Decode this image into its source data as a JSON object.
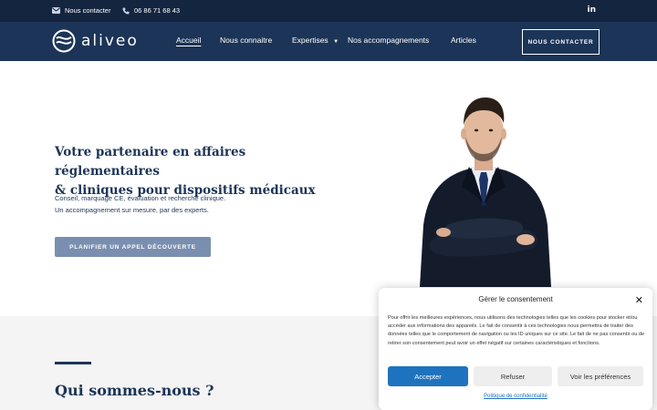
{
  "topbar": {
    "contact_label": "Nous contacter",
    "phone": "06 86 71 68 43",
    "linkedin": "in"
  },
  "nav": {
    "logo_text": "aliveo",
    "items": [
      {
        "label": "Accueil"
      },
      {
        "label": "Nous connaitre"
      },
      {
        "label": "Expertises"
      },
      {
        "label": "Nos accompagnements"
      },
      {
        "label": "Articles"
      }
    ],
    "cta": "NOUS CONTACTER"
  },
  "hero": {
    "title_line1": "Votre partenaire en affaires réglementaires",
    "title_line2": "& cliniques pour dispositifs médicaux",
    "subtitle_line1": "Conseil, marquage CE, évaluation et recherche clinique.",
    "subtitle_line2": "Un accompagnement sur mesure, par des experts.",
    "button": "PLANIFIER UN APPEL DÉCOUVERTE"
  },
  "section2": {
    "title": "Qui sommes-nous ?"
  },
  "cookie": {
    "title": "Gérer le consentement",
    "close": "✕",
    "text": "Pour offrir les meilleures expériences, nous utilisons des technologies telles que les cookies pour stocker et/ou accéder aux informations des appareils. Le fait de consentir à ces technologies nous permettra de traiter des données telles que le comportement de navigation ou les ID uniques sur ce site. Le fait de ne pas consentir ou de retirer son consentement peut avoir un effet négatif sur certaines caractéristiques et fonctions.",
    "accept": "Accepter",
    "refuse": "Refuser",
    "prefs": "Voir les préférences",
    "policy": "Politique de confidentialité"
  },
  "colors": {
    "topbar": "#142540",
    "navbar": "#1c3457",
    "hero_button": "#7a8fb0",
    "accept_button": "#1e73be"
  }
}
